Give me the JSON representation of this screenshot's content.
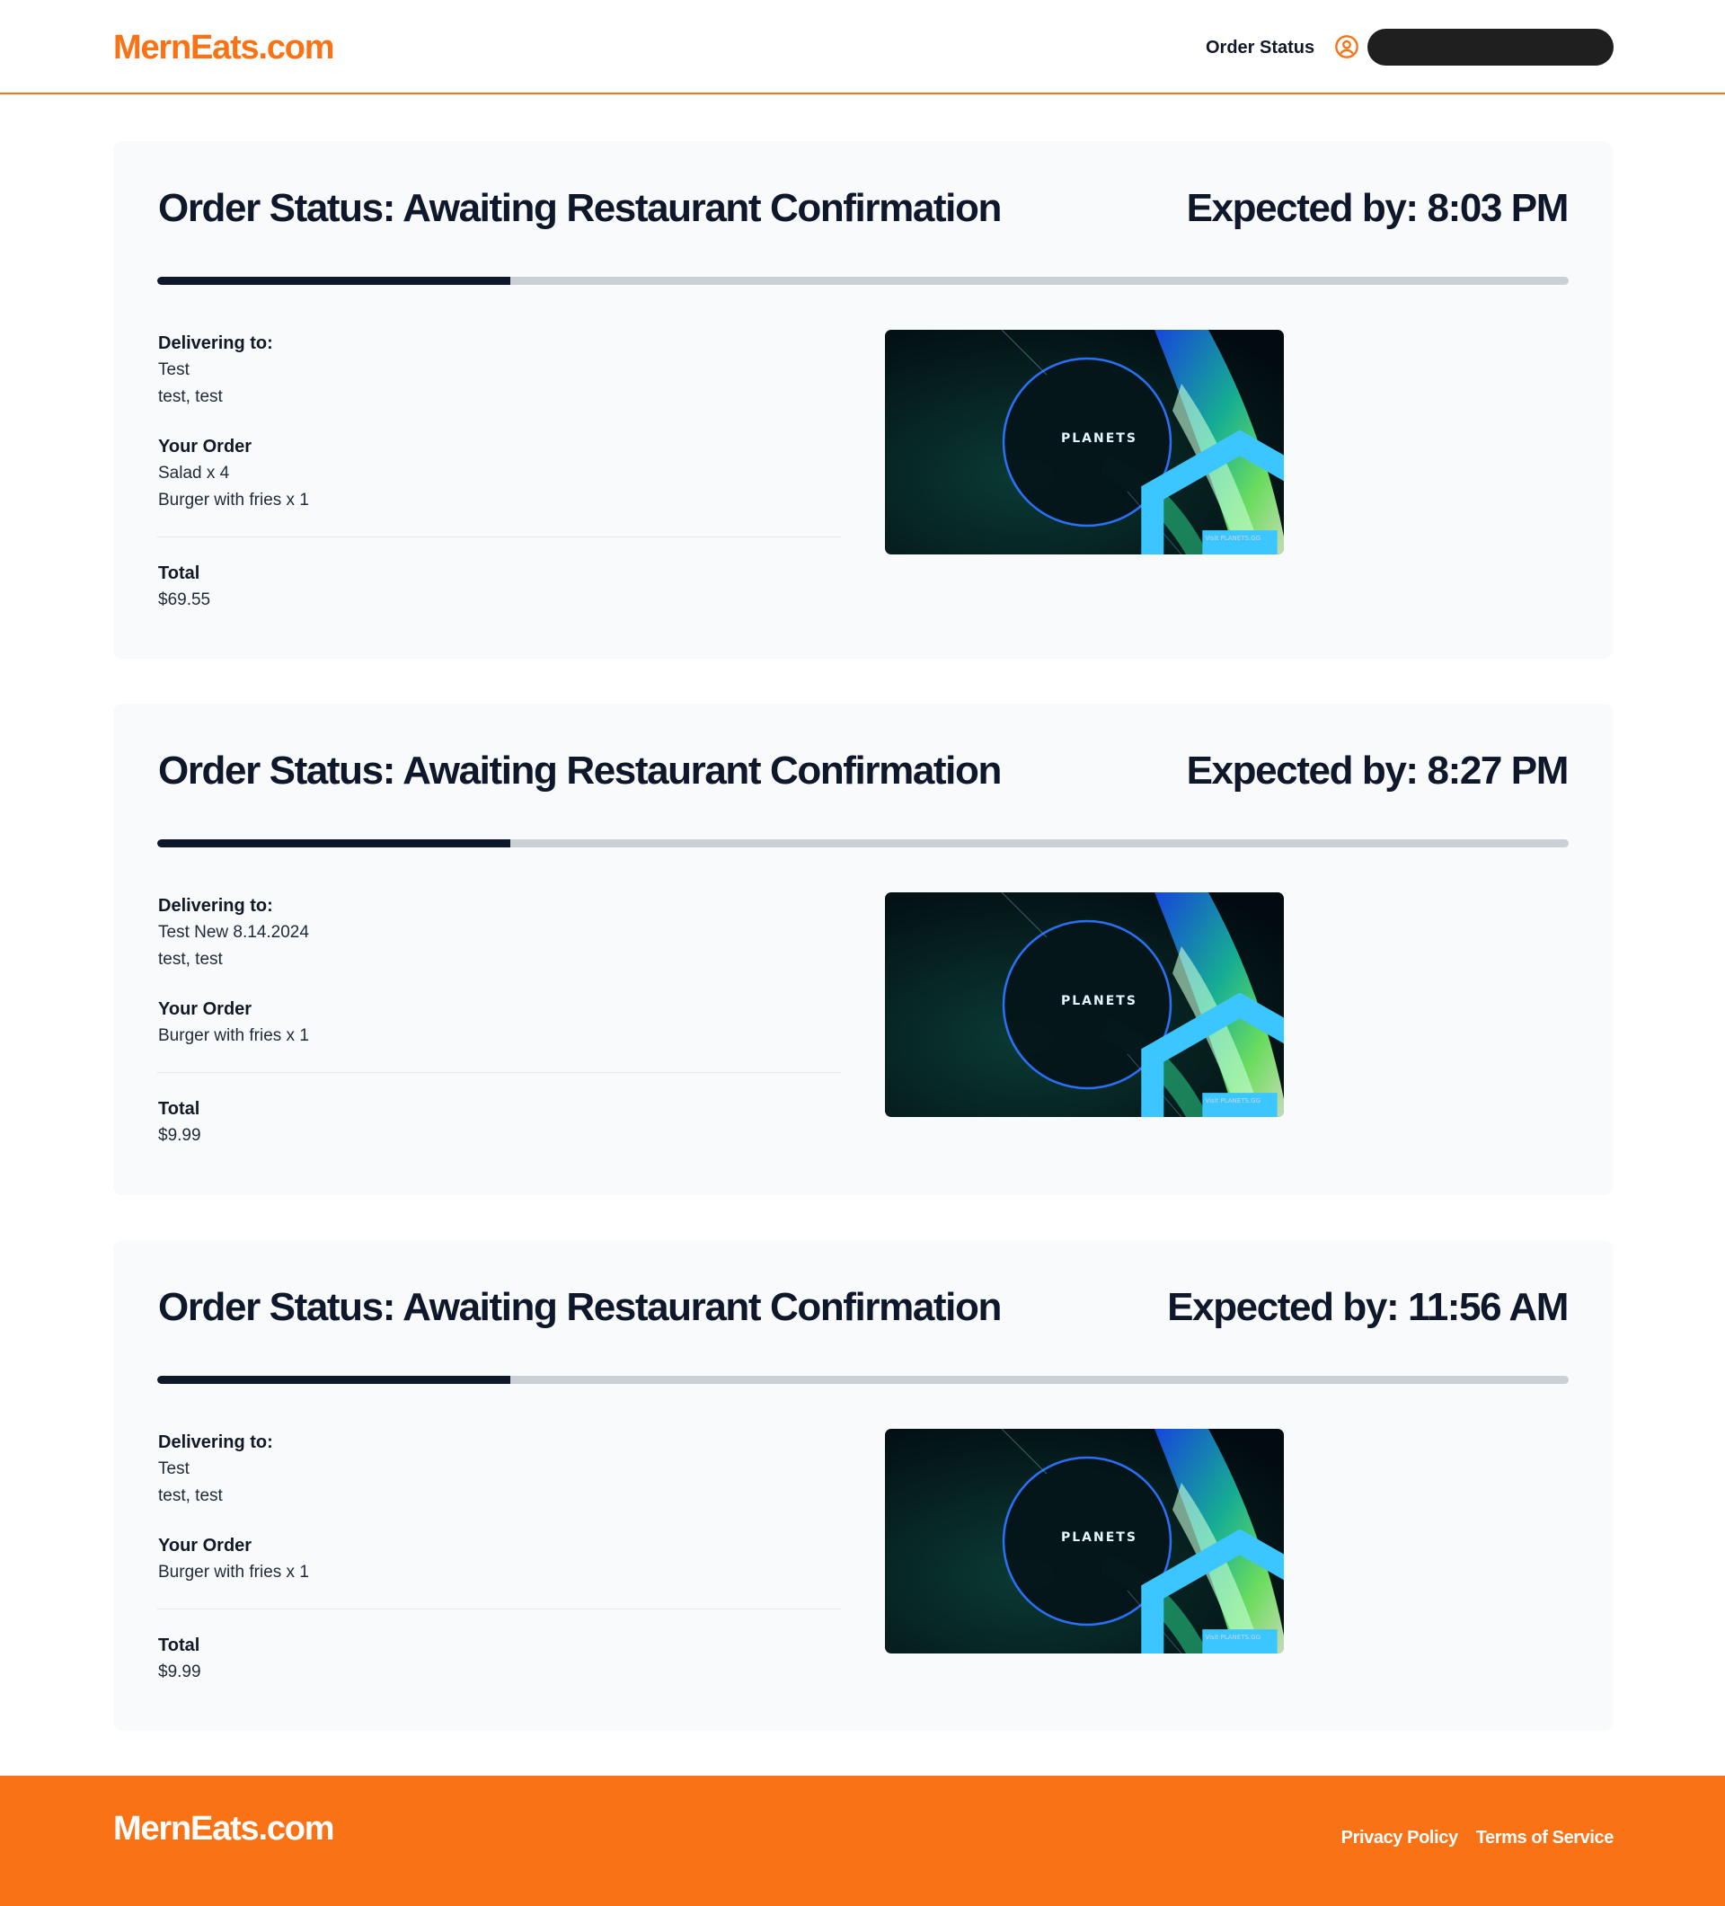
{
  "header": {
    "logo": "MernEats.com",
    "nav_order_status": "Order Status"
  },
  "orders": [
    {
      "status": "Order Status: Awaiting Restaurant Confirmation",
      "expected": "Expected by: 8:03 PM",
      "progress_percent": 25,
      "delivering_label": "Delivering to:",
      "name": "Test",
      "address": "test, test",
      "order_label": "Your Order",
      "items": [
        "Salad x 4",
        "Burger with fries x 1"
      ],
      "total_label": "Total",
      "total": "$69.55",
      "image_text": "PLANETS",
      "image_small_text": "Visit PLANETS.GG"
    },
    {
      "status": "Order Status: Awaiting Restaurant Confirmation",
      "expected": "Expected by: 8:27 PM",
      "progress_percent": 25,
      "delivering_label": "Delivering to:",
      "name": "Test New 8.14.2024",
      "address": "test, test",
      "order_label": "Your Order",
      "items": [
        "Burger with fries x 1"
      ],
      "total_label": "Total",
      "total": "$9.99",
      "image_text": "PLANETS",
      "image_small_text": "Visit PLANETS.GG"
    },
    {
      "status": "Order Status: Awaiting Restaurant Confirmation",
      "expected": "Expected by: 11:56 AM",
      "progress_percent": 25,
      "delivering_label": "Delivering to:",
      "name": "Test",
      "address": "test, test",
      "order_label": "Your Order",
      "items": [
        "Burger with fries x 1"
      ],
      "total_label": "Total",
      "total": "$9.99",
      "image_text": "PLANETS",
      "image_small_text": "Visit PLANETS.GG"
    }
  ],
  "footer": {
    "logo": "MernEats.com",
    "privacy": "Privacy Policy",
    "terms": "Terms of Service"
  },
  "colors": {
    "brand": "#f97316",
    "dark": "#0f172a",
    "card_bg": "#f8fafc",
    "progress_track": "#cbd0d6"
  }
}
